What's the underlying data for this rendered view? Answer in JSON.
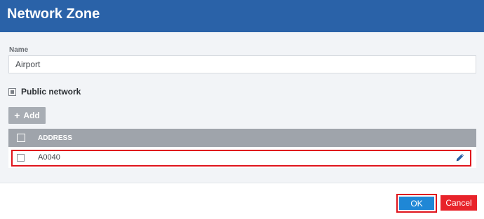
{
  "dialog": {
    "title": "Network Zone"
  },
  "form": {
    "name_label": "Name",
    "name_value": "Airport",
    "public_network_label": "Public network",
    "public_network_state": "indeterminate"
  },
  "toolbar": {
    "add_label": "Add",
    "add_icon": "plus-icon"
  },
  "table": {
    "columns": [
      "ADDRESS"
    ],
    "rows": [
      {
        "address": "A0040",
        "action_icon": "pencil-icon"
      }
    ]
  },
  "footer": {
    "ok_label": "OK",
    "cancel_label": "Cancel"
  },
  "colors": {
    "header_bg": "#2a62a8",
    "ok_bg": "#1f87d6",
    "cancel_bg": "#e8232a",
    "highlight": "#e0141c"
  }
}
